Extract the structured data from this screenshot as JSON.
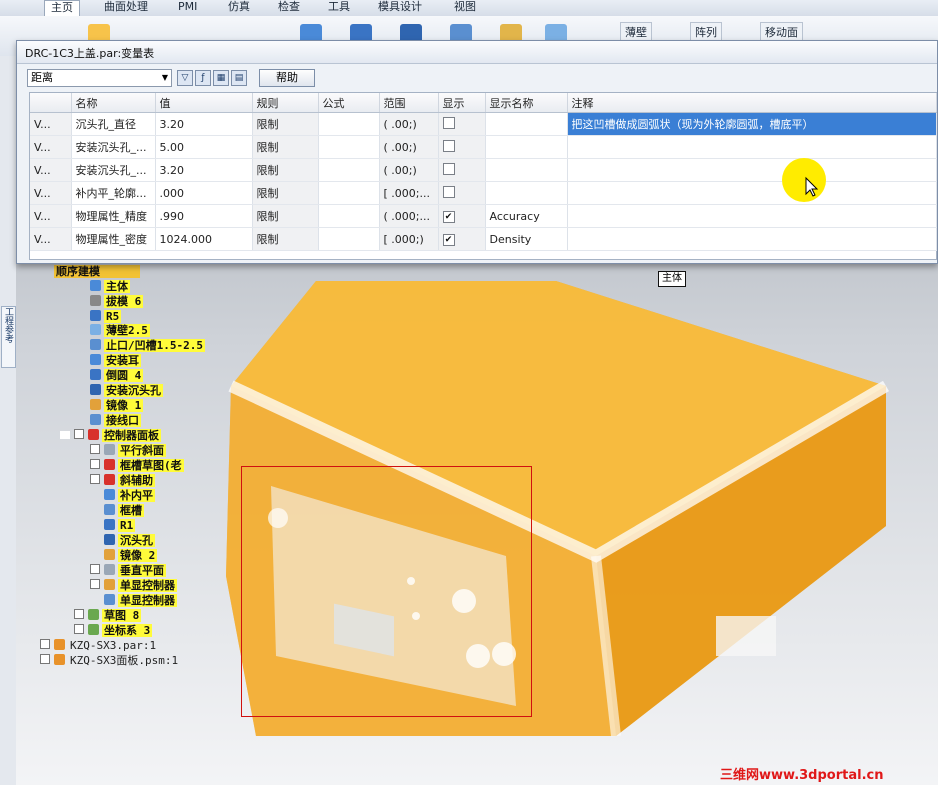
{
  "ribbon": {
    "tabs": [
      {
        "label": "主页",
        "active": true
      },
      {
        "label": "曲面处理"
      },
      {
        "label": "PMI"
      },
      {
        "label": "仿真"
      },
      {
        "label": "检查"
      },
      {
        "label": "工具"
      },
      {
        "label": "模具设计"
      },
      {
        "label": "视图"
      }
    ],
    "buttons": {
      "thin_wall": "薄壁",
      "array": "阵列",
      "move_face": "移动面"
    }
  },
  "left_rail": {
    "tab_label": "工程参考"
  },
  "dialog": {
    "title": "DRC-1C3上盖.par:变量表",
    "filter_select": "距离",
    "help_label": "帮助",
    "columns": [
      "",
      "名称",
      "值",
      "规则",
      "公式",
      "范围",
      "显示",
      "显示名称",
      "注释"
    ],
    "rows": [
      {
        "type": "V...",
        "name": "沉头孔_直径",
        "value": "3.20",
        "rule": "限制",
        "formula": "",
        "range": "( .00;)",
        "show": false,
        "display_name": "",
        "note": "把这凹槽做成圆弧状（现为外轮廓圆弧，槽底平）",
        "highlight": true
      },
      {
        "type": "V...",
        "name": "安装沉头孔_...",
        "value": "5.00",
        "rule": "限制",
        "formula": "",
        "range": "( .00;)",
        "show": false,
        "display_name": "",
        "note": ""
      },
      {
        "type": "V...",
        "name": "安装沉头孔_...",
        "value": "3.20",
        "rule": "限制",
        "formula": "",
        "range": "( .00;)",
        "show": false,
        "display_name": "",
        "note": ""
      },
      {
        "type": "V...",
        "name": "补内平_轮廓...",
        "value": ".000",
        "rule": "限制",
        "formula": "",
        "range": "[ .000;...",
        "show": false,
        "display_name": "",
        "note": ""
      },
      {
        "type": "V...",
        "name": "物理属性_精度",
        "value": ".990",
        "rule": "限制",
        "formula": "",
        "range": "( .000;...",
        "show": true,
        "display_name": "Accuracy",
        "note": ""
      },
      {
        "type": "V...",
        "name": "物理属性_密度",
        "value": "1024.000",
        "rule": "限制",
        "formula": "",
        "range": "[ .000;)",
        "show": true,
        "display_name": "Density",
        "note": ""
      }
    ]
  },
  "tree": {
    "items": [
      {
        "label": "顺序建模",
        "indent": 0,
        "style": "header"
      },
      {
        "label": "主体",
        "indent": 1,
        "icon": "body-icon"
      },
      {
        "label": "拔模 6",
        "indent": 1,
        "icon": "draft-icon"
      },
      {
        "label": "R5",
        "indent": 1,
        "icon": "round-icon"
      },
      {
        "label": "薄壁2.5",
        "indent": 1,
        "icon": "thinwall-icon"
      },
      {
        "label": "止口/凹槽1.5-2.5",
        "indent": 1,
        "icon": "lip-icon"
      },
      {
        "label": "安装耳",
        "indent": 1,
        "icon": "protrusion-icon"
      },
      {
        "label": "倒圆 4",
        "indent": 1,
        "icon": "round-icon"
      },
      {
        "label": "安装沉头孔",
        "indent": 1,
        "icon": "hole-icon"
      },
      {
        "label": "镜像 1",
        "indent": 1,
        "icon": "mirror-icon"
      },
      {
        "label": "接线口",
        "indent": 1,
        "icon": "cutout-icon"
      },
      {
        "label": "控制器面板",
        "indent": 1,
        "icon": "sketch-icon",
        "checkbox": true,
        "expander": true
      },
      {
        "label": "平行斜面",
        "indent": 2,
        "icon": "plane-icon",
        "checkbox": true
      },
      {
        "label": "框槽草图(老",
        "indent": 2,
        "icon": "sketch-icon",
        "checkbox": true
      },
      {
        "label": "斜辅助",
        "indent": 2,
        "icon": "sketch-icon",
        "checkbox": true
      },
      {
        "label": "补内平",
        "indent": 2,
        "icon": "protrusion-icon"
      },
      {
        "label": "框槽",
        "indent": 2,
        "icon": "cutout-icon"
      },
      {
        "label": "R1",
        "indent": 2,
        "icon": "round-icon"
      },
      {
        "label": "沉头孔",
        "indent": 2,
        "icon": "hole-icon"
      },
      {
        "label": "镜像 2",
        "indent": 2,
        "icon": "mirror-icon"
      },
      {
        "label": "垂直平面",
        "indent": 2,
        "icon": "plane-icon",
        "checkbox": true
      },
      {
        "label": "单显控制器",
        "indent": 2,
        "icon": "part-icon",
        "checkbox": true
      },
      {
        "label": "单显控制器",
        "indent": 2,
        "icon": "cutout-icon"
      },
      {
        "label": "草图 8",
        "indent": 1,
        "icon": "sketch-icon",
        "checkbox": true
      },
      {
        "label": "坐标系 3",
        "indent": 1,
        "icon": "csys-icon",
        "checkbox": true
      },
      {
        "label": "KZQ-SX3.par:1",
        "indent": 0,
        "icon": "part-icon",
        "checkbox": true,
        "style": "plain"
      },
      {
        "label": "KZQ-SX3面板.psm:1",
        "indent": 0,
        "icon": "sheetmetal-icon",
        "checkbox": true,
        "style": "plain"
      }
    ]
  },
  "viewport": {
    "tooltip": "主体"
  },
  "watermark": "三维网www.3dportal.cn",
  "colors": {
    "highlight": "#fffb3a",
    "model": "#f2a821",
    "selection": "#d01010",
    "note_highlight": "#3a7fd5"
  }
}
